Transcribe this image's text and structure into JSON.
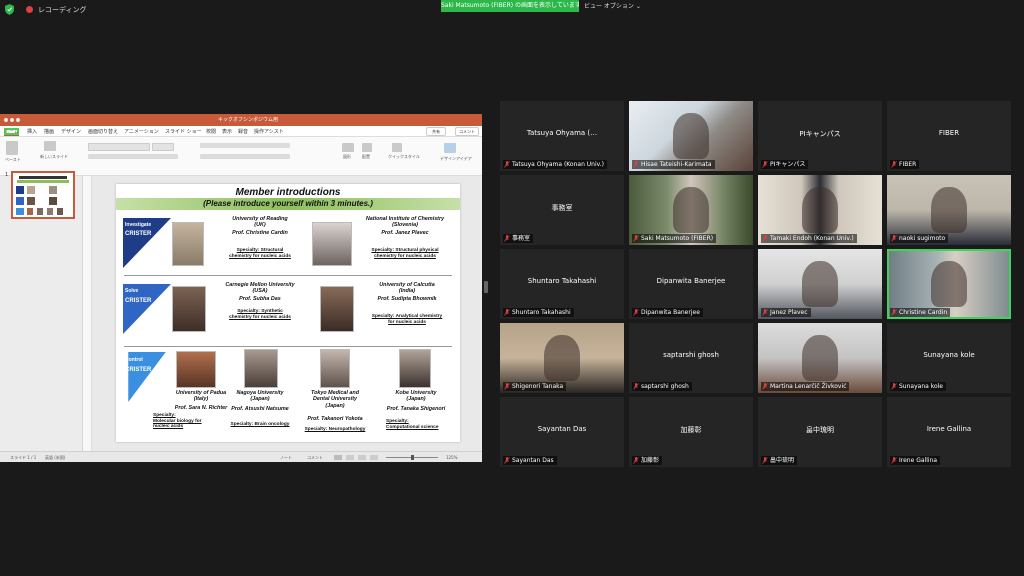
{
  "topbar": {
    "recording_label": "レコーディング",
    "share_banner": "Saki Matsumoto (FIBER) の画面を表示しています",
    "view_options": "ビュー オプション"
  },
  "ppt": {
    "file_title": "キックオフシンポジウム用",
    "menu": [
      "ホーム",
      "挿入",
      "描画",
      "デザイン",
      "画面切り替え",
      "アニメーション",
      "スライド ショー",
      "校閲",
      "表示",
      "録音",
      "操作アシスト"
    ],
    "share_label": "共有",
    "comment_label": "コメント",
    "ribbon_labels": [
      "ペースト",
      "新しいスライド",
      "図形",
      "配置",
      "クイックスタイル",
      "デザインアイデア"
    ],
    "slide_number": "1",
    "status_left": "スライド 1 / 1",
    "status_lang": "英語 (米国)",
    "status_notes": "ノート",
    "status_comments": "コメント",
    "zoom": "125%"
  },
  "slide": {
    "title": "Member introductions",
    "subtitle": "(Please introduce yourself within 3 minutes.)",
    "groups": [
      {
        "label": "Investigate",
        "crister": "CRISTER",
        "color": "#1f3c88"
      },
      {
        "label": "Solve",
        "crister": "CRISTER",
        "color": "#2f66c4"
      },
      {
        "label": "Control",
        "crister": "CRISTER",
        "color": "#3a8fe0"
      }
    ],
    "people": [
      {
        "inst": "University of Reading\n(UK)",
        "prof": "Prof. Christine Cardin",
        "spec": "Specialty: Structural\nchemistry for nucleic acids"
      },
      {
        "inst": "National Institute of Chemistry\n(Slovenia)",
        "prof": "Prof. Janez Plavec",
        "spec": "Specialty: Structural physical\nchemistry for nucleic acids"
      },
      {
        "inst": "Carnegie Mellon University\n(USA)",
        "prof": "Prof. Subha Das",
        "spec": "Specialty: Synthetic\nchemistry for nucleic acids"
      },
      {
        "inst": "University of Calcutta\n(India)",
        "prof": "Prof. Sudipta Bhowmik",
        "spec": "Specialty: Analytical chemistry\nfor nucleic acids"
      },
      {
        "inst": "University of Padua\n(Italy)",
        "prof": "Prof. Sara N. Richter",
        "spec": "Specialty:\nMolecular biology for\nnucleic acids"
      },
      {
        "inst": "Nagoya University\n(Japan)",
        "prof": "Prof. Atsushi Natsume",
        "spec": "Specialty: Brain oncology"
      },
      {
        "inst": "Tokyo Medical and\nDental University\n(Japan)",
        "prof": "Prof. Takanori Yokota",
        "spec": "Specialty: Neuropathology"
      },
      {
        "inst": "Kobe University\n(Japan)",
        "prof": "Prof. Tanaka Shigenori",
        "spec": "Specialty:\nComputational science"
      }
    ]
  },
  "participants": [
    {
      "name": "Tatsuya Ohyama (…",
      "label": "Tatsuya Ohyama (Konan Univ.)",
      "video": false
    },
    {
      "name": "",
      "label": "Hisae Tateishi-Karimata",
      "video": true
    },
    {
      "name": "PIキャンパス",
      "label": "PIキャンパス",
      "video": false
    },
    {
      "name": "FIBER",
      "label": "FIBER",
      "video": false
    },
    {
      "name": "事務室",
      "label": "事務室",
      "video": false
    },
    {
      "name": "",
      "label": "Saki Matsumoto (FIBER)",
      "video": true
    },
    {
      "name": "",
      "label": "Tamaki Endoh (Konan Univ.)",
      "video": true
    },
    {
      "name": "",
      "label": "naoki sugimoto",
      "video": true
    },
    {
      "name": "Shuntaro Takahashi",
      "label": "Shuntaro Takahashi",
      "video": false
    },
    {
      "name": "Dipanwita Banerjee",
      "label": "Dipanwita Banerjee",
      "video": false
    },
    {
      "name": "",
      "label": "Janez Plavec",
      "video": true
    },
    {
      "name": "",
      "label": "Christine Cardin",
      "video": true,
      "active": true
    },
    {
      "name": "",
      "label": "Shigenori Tanaka",
      "video": true
    },
    {
      "name": "saptarshi ghosh",
      "label": "saptarshi ghosh",
      "video": false
    },
    {
      "name": "",
      "label": "Martina Lenarčič Živković",
      "video": true
    },
    {
      "name": "Sunayana kole",
      "label": "Sunayana kole",
      "video": false
    },
    {
      "name": "Sayantan Das",
      "label": "Sayantan Das",
      "video": false
    },
    {
      "name": "加藤彰",
      "label": "加藤彰",
      "video": false
    },
    {
      "name": "畠中琉明",
      "label": "畠中琉明",
      "video": false
    },
    {
      "name": "Irene Gallina",
      "label": "Irene Gallina",
      "video": false
    }
  ]
}
